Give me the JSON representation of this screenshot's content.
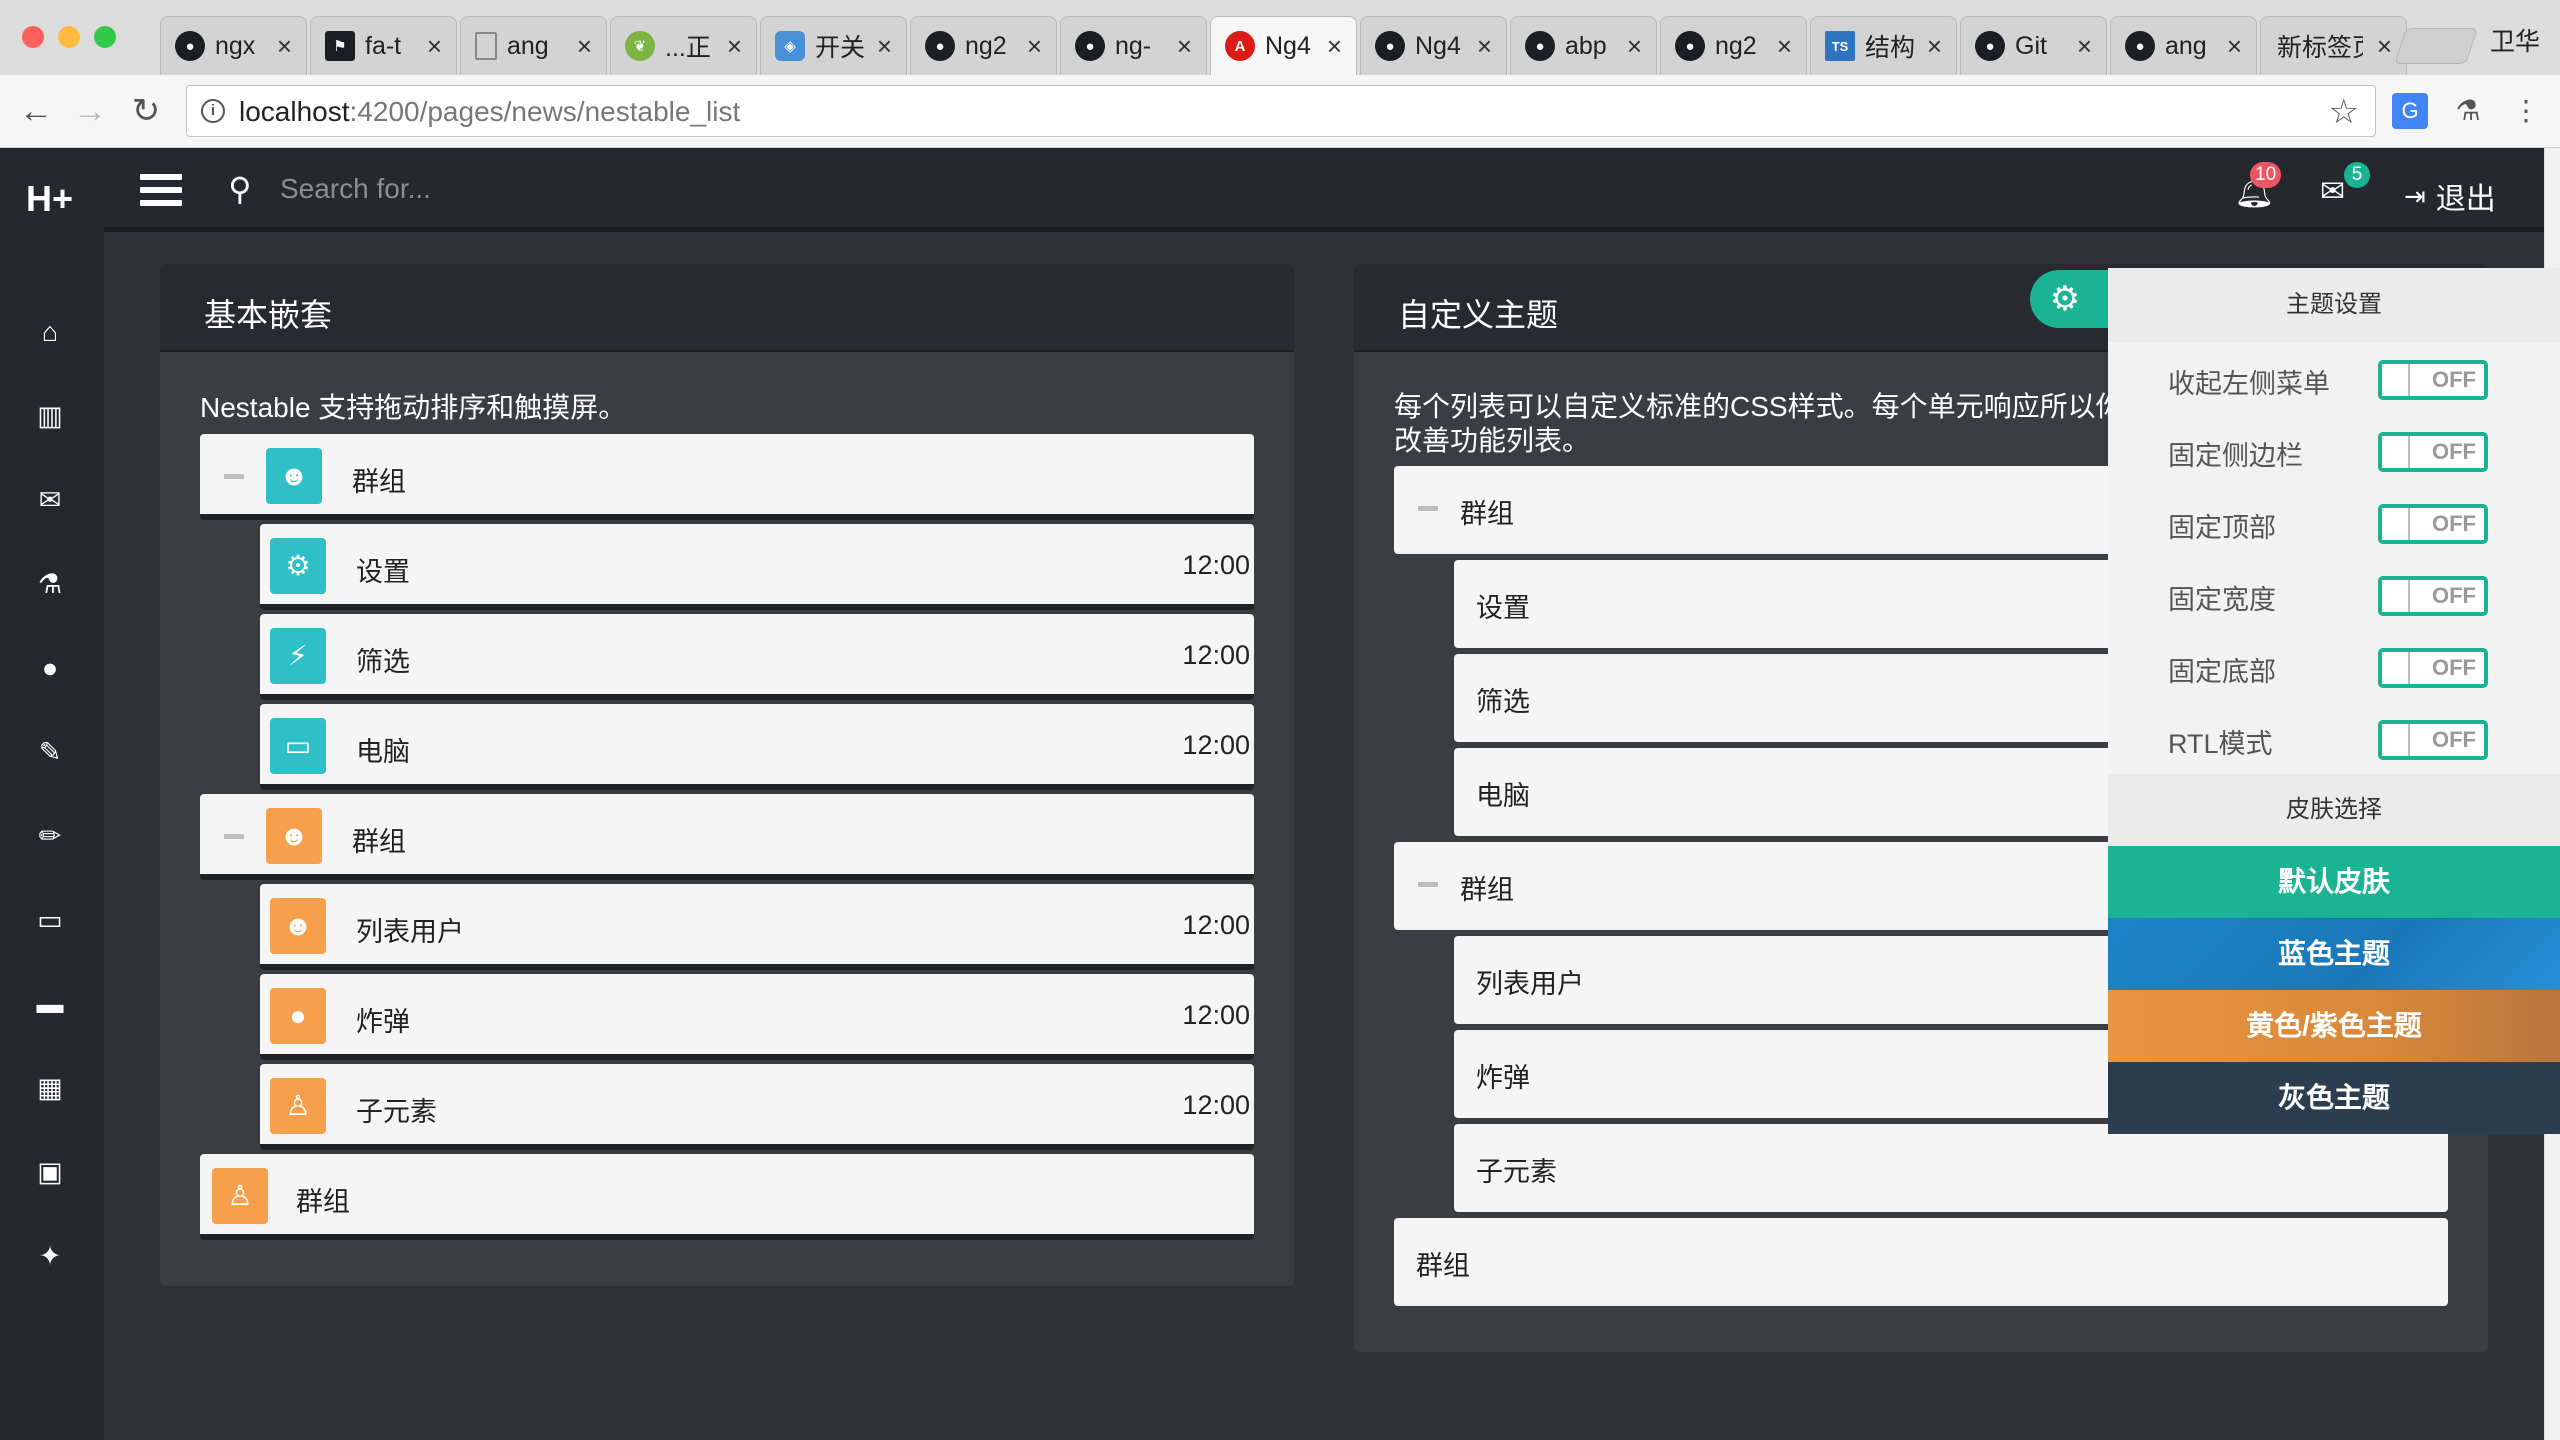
{
  "browser": {
    "tabs": [
      {
        "label": "ngx",
        "icon": "github-icon",
        "color": "#1b1f23"
      },
      {
        "label": "fa-t",
        "icon": "flag-icon",
        "color": "#1b1f23"
      },
      {
        "label": "ang",
        "icon": "page-icon",
        "color": "#9e9e9e"
      },
      {
        "label": "...正",
        "icon": "leaf-icon",
        "color": "#7cb342"
      },
      {
        "label": "开关",
        "icon": "shield-icon",
        "color": "#4a90d9"
      },
      {
        "label": "ng2",
        "icon": "github-icon",
        "color": "#1b1f23"
      },
      {
        "label": "ng-",
        "icon": "github-icon",
        "color": "#1b1f23"
      },
      {
        "label": "Ng4",
        "icon": "angular-icon",
        "color": "#dd1b16"
      },
      {
        "label": "Ng4",
        "icon": "github-icon",
        "color": "#1b1f23"
      },
      {
        "label": "abp",
        "icon": "github-icon",
        "color": "#1b1f23"
      },
      {
        "label": "ng2",
        "icon": "github-icon",
        "color": "#1b1f23"
      },
      {
        "label": "结构",
        "icon": "typescript-icon",
        "color": "#2f74c0"
      },
      {
        "label": "Git",
        "icon": "github-icon",
        "color": "#1b1f23"
      },
      {
        "label": "ang",
        "icon": "github-icon",
        "color": "#1b1f23"
      },
      {
        "label": "新标签页",
        "icon": "",
        "color": ""
      }
    ],
    "profile": "卫华",
    "url_host": "localhost",
    "url_rest": ":4200/pages/news/nestable_list"
  },
  "app": {
    "logo": "H+",
    "search_placeholder": "Search for...",
    "notifications": "10",
    "messages": "5",
    "logout": "退出",
    "sidebar_icons": [
      "home-icon",
      "bar-chart-icon",
      "envelope-icon",
      "flask-icon",
      "globe-icon",
      "edit-icon",
      "pencil-icon",
      "desktop-icon",
      "monitor-icon",
      "table-icon",
      "picture-icon",
      "magic-icon"
    ]
  },
  "left_panel": {
    "title": "基本嵌套",
    "desc_prefix": "Nestable",
    "desc_rest": " 支持拖动排序和触摸屏。",
    "groups": [
      {
        "label": "群组",
        "icon": "users-icon",
        "color": "#2ebfc7",
        "children": [
          {
            "label": "设置",
            "icon": "gear-icon",
            "time": "12:00"
          },
          {
            "label": "筛选",
            "icon": "bolt-icon",
            "time": "12:00"
          },
          {
            "label": "电脑",
            "icon": "laptop-icon",
            "time": "12:00"
          }
        ]
      },
      {
        "label": "群组",
        "icon": "users-icon",
        "color": "#f6a04c",
        "children": [
          {
            "label": "列表用户",
            "icon": "users-icon",
            "time": "12:00"
          },
          {
            "label": "炸弹",
            "icon": "bomb-icon",
            "time": "12:00"
          },
          {
            "label": "子元素",
            "icon": "child-icon",
            "time": "12:00"
          }
        ]
      },
      {
        "label": "群组",
        "icon": "child-icon",
        "color": "#f6a04c",
        "children": []
      }
    ]
  },
  "right_panel": {
    "title": "自定义主题",
    "desc_line1": "每个列表可以自定义标准的CSS样式。每个单元响应所以你",
    "desc_line2": "改善功能列表。",
    "items": {
      "group1": "群组",
      "c1": "设置",
      "c2": "筛选",
      "c3": "电脑",
      "group2": "群组",
      "c4": "列表用户",
      "c5": "炸弹",
      "c6": "子元素",
      "group3": "群组"
    }
  },
  "theme_drawer": {
    "title": "主题设置",
    "settings": [
      {
        "label": "收起左侧菜单",
        "state": "OFF"
      },
      {
        "label": "固定侧边栏",
        "state": "OFF"
      },
      {
        "label": "固定顶部",
        "state": "OFF"
      },
      {
        "label": "固定宽度",
        "state": "OFF"
      },
      {
        "label": "固定底部",
        "state": "OFF"
      },
      {
        "label": "RTL模式",
        "state": "OFF"
      }
    ],
    "skin_title": "皮肤选择",
    "skins": [
      {
        "label": "默认皮肤",
        "color": "#1ab394"
      },
      {
        "label": "蓝色主题",
        "color": "#1c84c6"
      },
      {
        "label": "黄色/紫色主题",
        "color": "#e8953f"
      },
      {
        "label": "灰色主题",
        "color": "#2b3e50"
      }
    ]
  },
  "colors": {
    "accent": "#1ab394",
    "teal": "#2ebfc7",
    "orange": "#f6a04c",
    "badge_red": "#ed5565",
    "badge_green": "#1ab394"
  }
}
